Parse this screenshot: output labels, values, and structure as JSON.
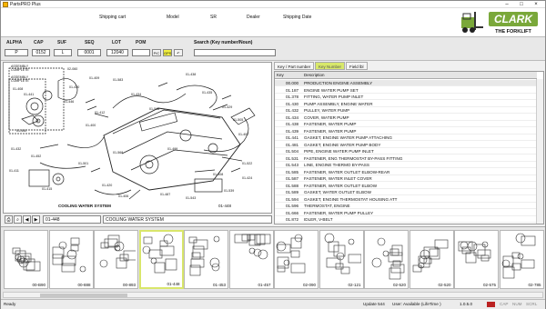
{
  "window": {
    "title": "PartsPRO Plus",
    "minimize_icon": "minimize-icon",
    "maximize_icon": "maximize-icon",
    "close_icon": "close-icon"
  },
  "header": {
    "shipping_cart": "Shipping cart",
    "model": "Model",
    "sr": "SR",
    "dealer": "Dealer",
    "shipping_date": "Shipping Date",
    "logo_text": "CLARK",
    "logo_tagline": "THE FORKLIFT"
  },
  "fields": {
    "alpha": {
      "label": "ALPHA",
      "value": "P"
    },
    "cap": {
      "label": "CAP",
      "value": "0152"
    },
    "suf": {
      "label": "SUF",
      "value": "L"
    },
    "seq": {
      "label": "SEQ",
      "value": "0001"
    },
    "lot": {
      "label": "LOT",
      "value": "12040"
    },
    "pom": {
      "label": "POM",
      "value": ""
    },
    "btn1": "PIC",
    "btn2": "GPS",
    "search": {
      "label": "Search (Key number/Noun)",
      "value": ""
    }
  },
  "diagram": {
    "caption": "COOLING WATER SYSTEM",
    "code": "01-448",
    "callouts": [
      "01-409",
      "01-430",
      "01-446",
      "01-408",
      "01-441",
      "01-440",
      "01-432",
      "01-583",
      "01-434",
      "01-438",
      "01-435",
      "01-429",
      "01-505",
      "01-407",
      "01-522",
      "01-408",
      "01-412",
      "01-400",
      "01-501",
      "01-452",
      "01-420",
      "01-406",
      "01-487",
      "01-543",
      "01-539",
      "01-424",
      "01-415",
      "01-411",
      "01-548",
      "01-412",
      "01-505",
      "01-499",
      "02-060",
      "01-568"
    ],
    "assembly_labels": [
      "ASSEMBLY COMPLETE",
      "ASSEMBLY COMPLETE"
    ]
  },
  "diagram_toolbar": {
    "page_code": "01-448",
    "page_title": "COOLING WATER SYSTEM"
  },
  "parts_tabs": [
    "Key / Part number",
    "Key Number",
    "Field lbl"
  ],
  "parts_grid": {
    "headers": [
      "Key",
      "Description"
    ],
    "rows": [
      {
        "key": "00.000",
        "desc": "PRODUCTION ENGINE ASSEMBLY"
      },
      {
        "key": "01.187",
        "desc": "ENGINE WATER PUMP SET"
      },
      {
        "key": "01.378",
        "desc": "FITTING, WATER PUMP INLET"
      },
      {
        "key": "01.430",
        "desc": "PUMP ASSEMBLY, ENGINE WATER"
      },
      {
        "key": "01.432",
        "desc": "PULLEY, WATER PUMP"
      },
      {
        "key": "01.434",
        "desc": "COVER, WATER PUMP"
      },
      {
        "key": "01.438",
        "desc": "FASTENER, WATER PUMP"
      },
      {
        "key": "01.439",
        "desc": "FASTENER, WATER PUMP"
      },
      {
        "key": "01.441",
        "desc": "GASKET, ENGINE WATER PUMP ATTACHING"
      },
      {
        "key": "01.481",
        "desc": "GASKET, ENGINE WATER PUMP BODY"
      },
      {
        "key": "01.504",
        "desc": "PIPE, ENGINE WATER PUMP INLET"
      },
      {
        "key": "01.531",
        "desc": "FASTENER, ENG THERMOSTAT BY-PASS FITTING"
      },
      {
        "key": "01.543",
        "desc": "LINE, ENGINE THERMO BY-PASS"
      },
      {
        "key": "01.585",
        "desc": "FASTENER, WATER OUTLET ELBOW-REAR"
      },
      {
        "key": "01.587",
        "desc": "FASTENER, WATER INLET COVER"
      },
      {
        "key": "01.588",
        "desc": "FASTENER, WATER OUTLET ELBOW"
      },
      {
        "key": "01.589",
        "desc": "GASKET, WATER OUTLET ELBOW"
      },
      {
        "key": "01.594",
        "desc": "GASKET, ENGINE THERMOSTAT HOUSING ATT"
      },
      {
        "key": "01.596",
        "desc": "THERMOSTAT, ENGINE"
      },
      {
        "key": "01.666",
        "desc": "FASTENER, WATER PUMP PULLEY"
      },
      {
        "key": "01.872",
        "desc": "IDLER, V-BELT"
      }
    ]
  },
  "thumbnails": [
    {
      "label": "00-B90"
    },
    {
      "label": "00-888"
    },
    {
      "label": "00-893"
    },
    {
      "label": "01-448",
      "active": true
    },
    {
      "label": "01-453"
    },
    {
      "label": "01-457"
    },
    {
      "label": "02-090"
    },
    {
      "label": "02-121"
    },
    {
      "label": "02-520"
    },
    {
      "label": "02-520"
    },
    {
      "label": "02-575"
    },
    {
      "label": "02-785"
    }
  ],
  "status": {
    "left": "Ready",
    "update": "Update 544",
    "lifetime": "User: Available (LifeTime )",
    "version": "1.0.5.0",
    "caps": "CAP",
    "num": "NUM",
    "scrl": "SCRL"
  }
}
